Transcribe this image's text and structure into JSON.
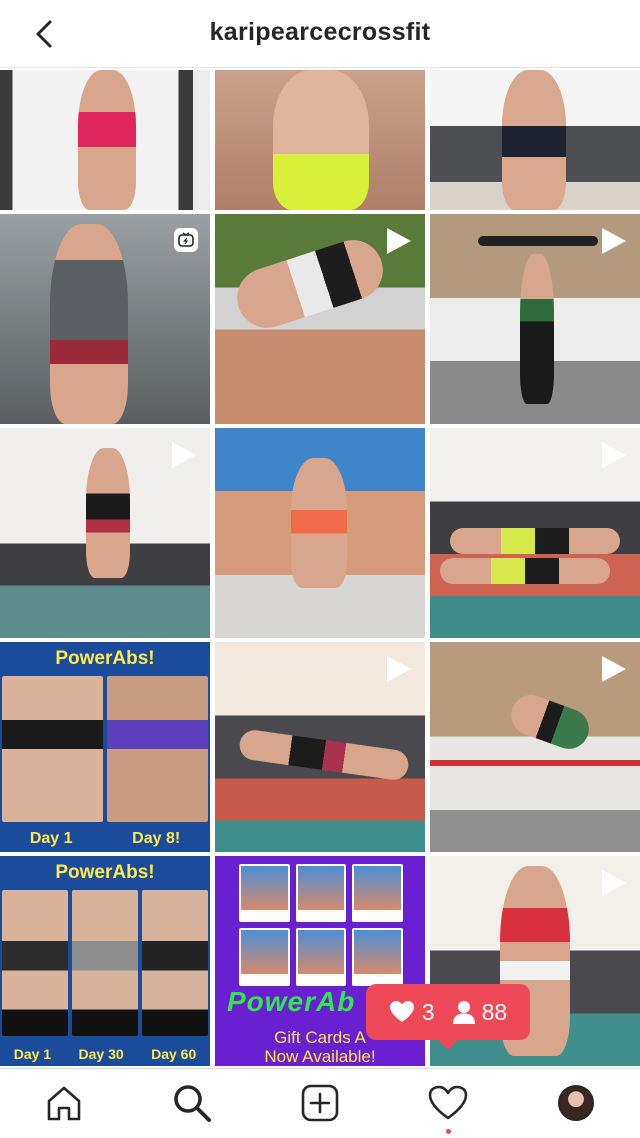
{
  "header": {
    "title": "karipearcecrossfit",
    "back_icon": "chevron-left-icon"
  },
  "grid": {
    "posts": [
      {
        "id": "gym-rings",
        "type": "photo"
      },
      {
        "id": "closeup",
        "type": "photo"
      },
      {
        "id": "couch-stand",
        "type": "photo"
      },
      {
        "id": "gym-standing",
        "type": "igtv"
      },
      {
        "id": "yard-side-plank",
        "type": "video"
      },
      {
        "id": "barbell-lift",
        "type": "video"
      },
      {
        "id": "tuck-jump",
        "type": "video"
      },
      {
        "id": "yard-jump",
        "type": "photo"
      },
      {
        "id": "partner-plank",
        "type": "video"
      },
      {
        "id": "powerabs-before-after",
        "type": "photo"
      },
      {
        "id": "floor-leg-lift",
        "type": "video"
      },
      {
        "id": "ring-swing",
        "type": "video"
      },
      {
        "id": "powerabs-results",
        "type": "photo"
      },
      {
        "id": "gift-cards-promo",
        "type": "photo"
      },
      {
        "id": "room-jump",
        "type": "video"
      }
    ],
    "powerabs1": {
      "title": "PowerAbs!",
      "labels": [
        "Day 1",
        "Day 8!"
      ]
    },
    "powerabs2": {
      "title": "PowerAbs!",
      "labels": [
        "Day 1",
        "Day 30",
        "Day 60"
      ]
    },
    "promo": {
      "brand": "PowerAb",
      "line1": "Gift Cards A",
      "line2": "Now Available!"
    }
  },
  "activity": {
    "likes": "3",
    "follows": "88"
  },
  "nav": {
    "items": [
      "home-icon",
      "search-icon",
      "new-post-icon",
      "activity-heart-icon",
      "profile-avatar"
    ]
  },
  "colors": {
    "accent": "#ed4956",
    "powerabs_bg": "#1b4b9b",
    "promo_bg": "#6a1fd1"
  }
}
